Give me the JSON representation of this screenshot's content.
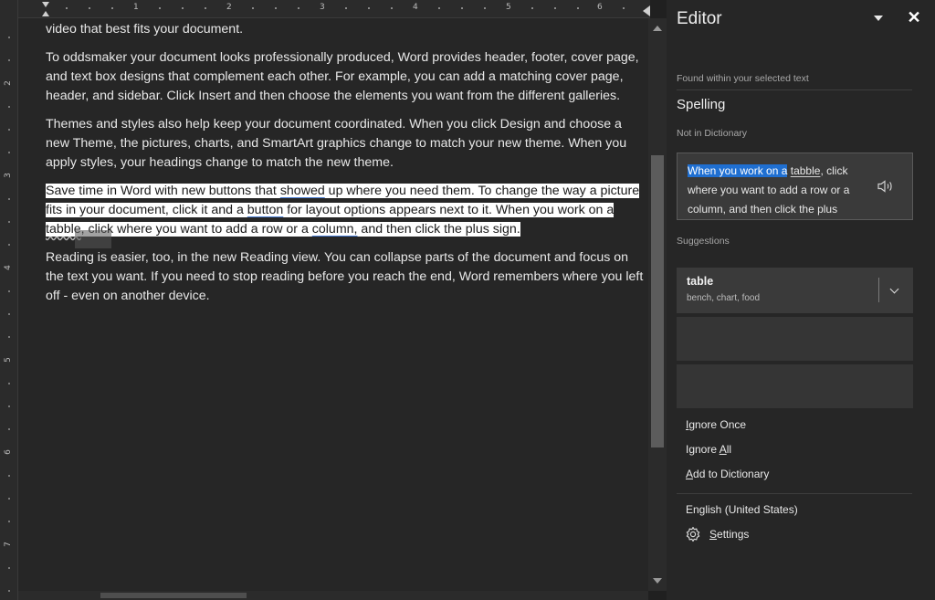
{
  "ruler": {
    "top_numbers": [
      "1",
      "2",
      "3",
      "4",
      "5",
      "6"
    ],
    "left_numbers": [
      "2",
      "3",
      "4",
      "5",
      "6",
      "7"
    ]
  },
  "document": {
    "p0": "video that best fits your document.",
    "p1": "To oddsmaker your document looks professionally produced, Word provides header, footer, cover page, and text box designs that complement each other. For example, you can add a matching cover page, header, and sidebar. Click Insert and then choose the elements you want from the different galleries.",
    "p2": "Themes and styles also help keep your document coordinated. When you click Design and choose a new Theme, the pictures, charts, and SmartArt graphics change to match your new theme. When you apply styles, your headings change to match the new theme.",
    "p3": {
      "a": "Save time in Word with new buttons that ",
      "b": "showed",
      "c": " up where you need them. To change the way a picture fits in your document, click it and a ",
      "d": "button",
      "e": " for layout options appears next to it. When you work on a ",
      "f": "tabble",
      "g": ", click where you want to add a row or a ",
      "h": "column,",
      "i": "  and then click the plus sign."
    },
    "p4": "Reading is easier, too, in the new Reading view. You can collapse parts of the document and focus on the text you want. If you need to stop reading before you reach the end, Word remembers where you left off - even on another device."
  },
  "editor": {
    "title": "Editor",
    "found_label": "Found within your selected text",
    "category": "Spelling",
    "subcategory": "Not in Dictionary",
    "context": {
      "highlighted": "When you work on a",
      "error_word": "tabble",
      "rest": ", click where you want to add a row or a column,  and then click the plus"
    },
    "suggestions_label": "Suggestions",
    "suggestion": {
      "word": "table",
      "synonyms": "bench, chart, food"
    },
    "actions": {
      "ignore_once_acc": "I",
      "ignore_once_rest": "gnore Once",
      "ignore_all_pre": "Ignore ",
      "ignore_all_acc": "A",
      "ignore_all_rest": "ll",
      "add_dict_pre": "",
      "add_dict_acc": "A",
      "add_dict_rest": "dd to Dictionary"
    },
    "language": "English (United States)",
    "settings_acc": "S",
    "settings_rest": "ettings"
  },
  "colors": {
    "accent": "#1f6fd1",
    "background": "#202020"
  }
}
